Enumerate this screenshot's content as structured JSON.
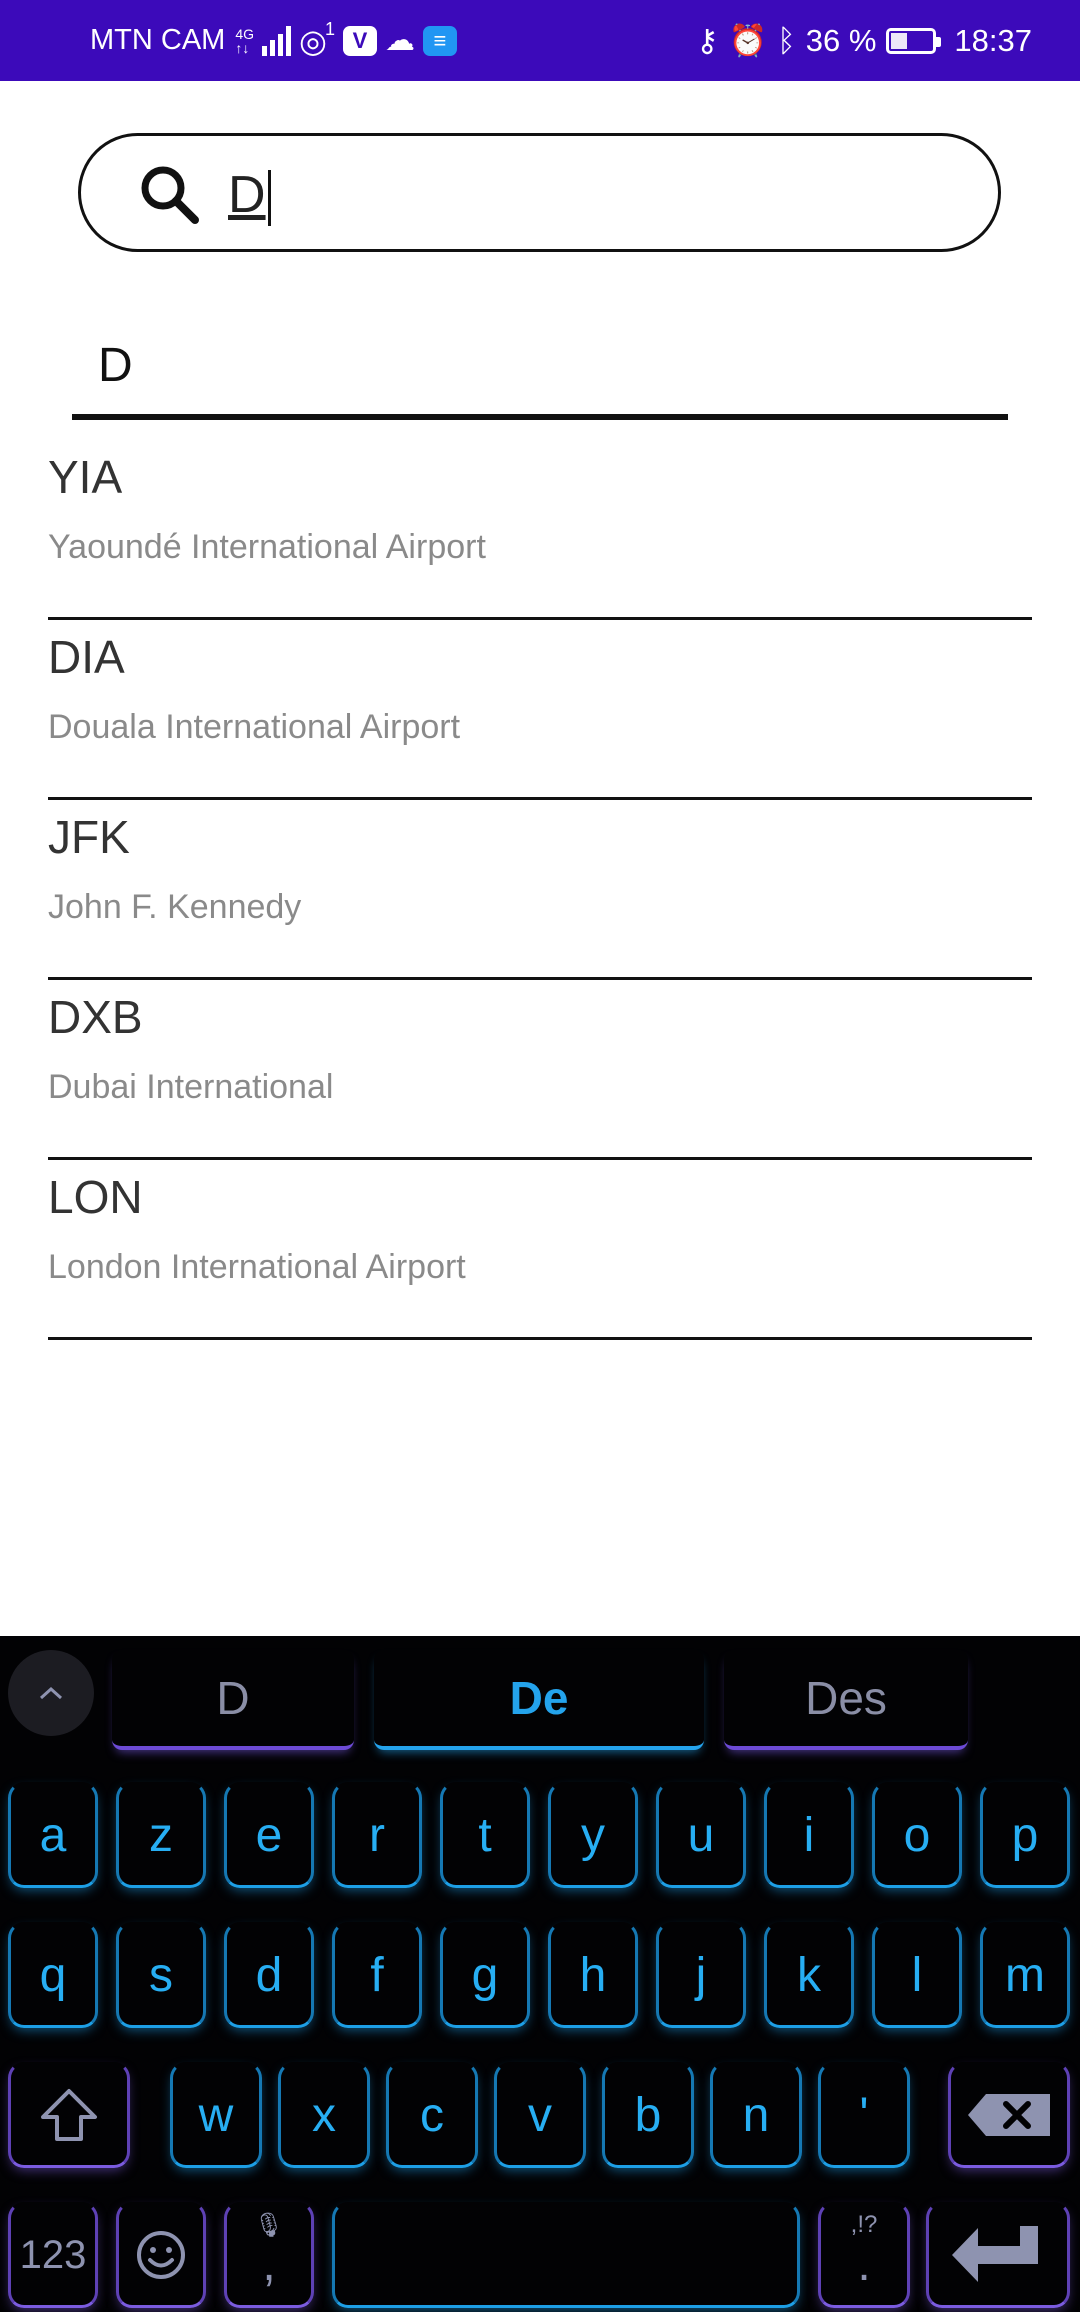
{
  "status_bar": {
    "carrier": "MTN CAM",
    "network": "4G",
    "notification_count": "1",
    "battery": "36 %",
    "battery_level": 0.36,
    "time": "18:37"
  },
  "search": {
    "value": "D"
  },
  "filter": {
    "value": "D"
  },
  "airports": [
    {
      "code": "YIA",
      "name": "Yaoundé International Airport"
    },
    {
      "code": "DIA",
      "name": "Douala International Airport"
    },
    {
      "code": "JFK",
      "name": "John F. Kennedy"
    },
    {
      "code": "DXB",
      "name": "Dubai International"
    },
    {
      "code": "LON",
      "name": "London International Airport"
    }
  ],
  "keyboard": {
    "suggestions": [
      "D",
      "De",
      "Des"
    ],
    "row1": [
      "a",
      "z",
      "e",
      "r",
      "t",
      "y",
      "u",
      "i",
      "o",
      "p"
    ],
    "row2": [
      "q",
      "s",
      "d",
      "f",
      "g",
      "h",
      "j",
      "k",
      "l",
      "m"
    ],
    "row3": [
      "w",
      "x",
      "c",
      "v",
      "b",
      "n",
      "'"
    ],
    "numbers_key": "123",
    "comma_key": ",",
    "period_key": ".",
    "period_alt": ",!?"
  },
  "colors": {
    "status_bar": "#3c0aba",
    "key_accent": "#27aef3",
    "key_alt_accent": "#7b5ce0",
    "keyboard_bg": "#020204"
  }
}
